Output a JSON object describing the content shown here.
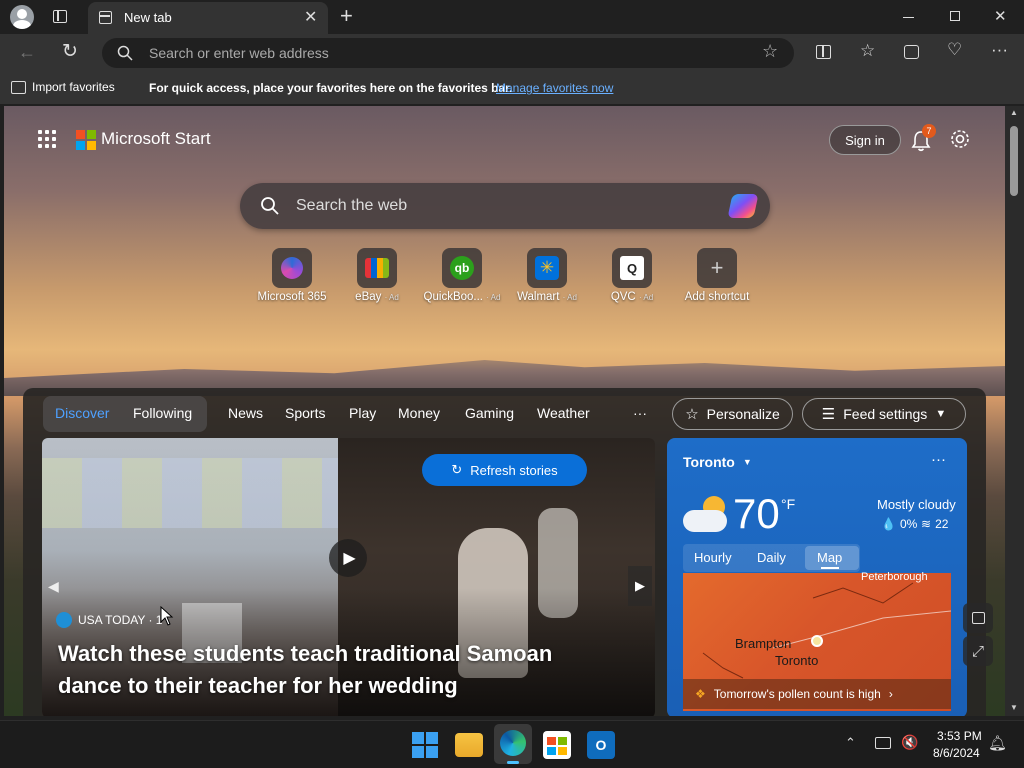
{
  "browser": {
    "tab_title": "New tab",
    "address_placeholder": "Search or enter web address",
    "favorites_bar": {
      "import_label": "Import favorites",
      "message": "For quick access, place your favorites here on the favorites bar.",
      "manage_link": "Manage favorites now"
    }
  },
  "start": {
    "brand": "Microsoft Start",
    "sign_in": "Sign in",
    "notification_count": "7",
    "search_placeholder": "Search the web",
    "shortcuts": [
      {
        "label": "Microsoft 365",
        "ad": ""
      },
      {
        "label": "eBay",
        "ad": "· Ad"
      },
      {
        "label": "QuickBoo...",
        "ad": "· Ad"
      },
      {
        "label": "Walmart",
        "ad": "· Ad"
      },
      {
        "label": "QVC",
        "ad": "· Ad"
      },
      {
        "label": "Add shortcut",
        "ad": ""
      }
    ],
    "feed_tabs": [
      "Discover",
      "Following",
      "News",
      "Sports",
      "Play",
      "Money",
      "Gaming",
      "Weather",
      "···"
    ],
    "personalize": "Personalize",
    "feed_settings": "Feed settings",
    "refresh": "Refresh stories",
    "story": {
      "source": "USA TODAY · 1",
      "headline": "Watch these students teach traditional Samoan dance to their teacher for her wedding"
    },
    "weather": {
      "city": "Toronto",
      "temp": "70",
      "unit": "°F",
      "condition": "Mostly cloudy",
      "precip": "0%",
      "wind": "22",
      "tabs": [
        "Hourly",
        "Daily",
        "Map"
      ],
      "map_labels": [
        "Peterborough",
        "Brampton",
        "Toronto"
      ],
      "pollen": "Tomorrow's pollen count is high"
    }
  },
  "taskbar": {
    "time": "3:53 PM",
    "date": "8/6/2024"
  },
  "colors": {
    "accent": "#0a6fd8",
    "weather_bg": "#1e6dc8",
    "map": "#e0602c"
  }
}
